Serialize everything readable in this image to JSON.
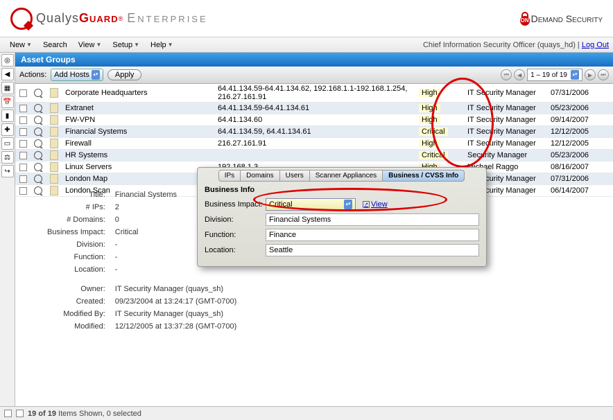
{
  "logo": {
    "part1": "Qualys",
    "part2": "Guard",
    "reg": "®",
    "part3": "Enterprise"
  },
  "ods": {
    "on": "ON",
    "text": "Demand Security"
  },
  "menu": [
    "New",
    "Search",
    "View",
    "Setup",
    "Help"
  ],
  "menu_dd": [
    true,
    false,
    true,
    true,
    true
  ],
  "user_line": "Chief Information Security Officer (quays_hd) | ",
  "logout": "Log Out",
  "section_title": "Asset Groups",
  "actions_label": "Actions:",
  "actions_value": "Add Hosts",
  "apply": "Apply",
  "pager": "1 – 19 of 19",
  "rows": [
    {
      "name": "Corporate Headquarters",
      "ips": "64.41.134.59-64.41.134.62, 192.168.1.1-192.168.1.254, 216.27.161.91",
      "impact": "High",
      "owner": "IT Security Manager",
      "date": "07/31/2006"
    },
    {
      "name": "Extranet",
      "ips": "64.41.134.59-64.41.134.61",
      "impact": "High",
      "owner": "IT Security Manager",
      "date": "05/23/2006"
    },
    {
      "name": "FW-VPN",
      "ips": "64.41.134.60",
      "impact": "High",
      "owner": "IT Security Manager",
      "date": "09/14/2007"
    },
    {
      "name": "Financial Systems",
      "ips": "64.41.134.59, 64.41.134.61",
      "impact": "Critical",
      "owner": "IT Security Manager",
      "date": "12/12/2005"
    },
    {
      "name": "Firewall",
      "ips": "216.27.161.91",
      "impact": "High",
      "owner": "IT Security Manager",
      "date": "12/12/2005"
    },
    {
      "name": "HR Systems",
      "ips": "",
      "impact": "Critical",
      "owner": "Security Manager",
      "date": "05/23/2006"
    },
    {
      "name": "Linux Servers",
      "ips": "192.168.1.3",
      "impact": "High",
      "owner": "Michael Raggo",
      "date": "08/16/2007"
    },
    {
      "name": "London Map",
      "ips": "",
      "impact": "",
      "owner": "IT Security Manager",
      "date": "07/31/2006"
    },
    {
      "name": "London Scan",
      "ips": "",
      "impact": "",
      "owner": "IT Security Manager",
      "date": "06/14/2007"
    }
  ],
  "details": {
    "Title": "Financial Systems",
    "IPs": "2",
    "Domains": "0",
    "BusinessImpact": "Critical",
    "Division": "-",
    "Function": "-",
    "Location": "-",
    "Owner": "IT Security Manager (quays_sh)",
    "Created": "09/23/2004 at 13:24:17 (GMT-0700)",
    "ModifiedBy": "IT Security Manager (quays_sh)",
    "Modified": "12/12/2005 at 13:37:28 (GMT-0700)"
  },
  "detail_labels": {
    "Title": "Title:",
    "IPs": "# IPs:",
    "Domains": "# Domains:",
    "BusinessImpact": "Business Impact:",
    "Division": "Division:",
    "Function": "Function:",
    "Location": "Location:",
    "Owner": "Owner:",
    "Created": "Created:",
    "ModifiedBy": "Modified By:",
    "Modified": "Modified:"
  },
  "tabs": [
    "IPs",
    "Domains",
    "Users",
    "Scanner Appliances",
    "Business / CVSS Info"
  ],
  "active_tab": 4,
  "popup": {
    "header": "Business Info",
    "fields": {
      "business_impact_label": "Business Impact:",
      "business_impact_value": "Critical",
      "division_label": "Division:",
      "division_value": "Financial Systems",
      "function_label": "Function:",
      "function_value": "Finance",
      "location_label": "Location:",
      "location_value": "Seattle"
    },
    "view": "View"
  },
  "status": {
    "count": "19 of 19",
    "text": "Items Shown,  0 selected"
  },
  "side_icons": [
    "target-icon",
    "left-icon",
    "grid-icon",
    "cal-icon",
    "chart-icon",
    "plus-icon",
    "doc-icon",
    "scale-icon",
    "exit-icon"
  ],
  "side_glyph": [
    "◎",
    "◀",
    "▦",
    "📅",
    "▮",
    "✚",
    "▭",
    "⚖",
    "↪"
  ]
}
